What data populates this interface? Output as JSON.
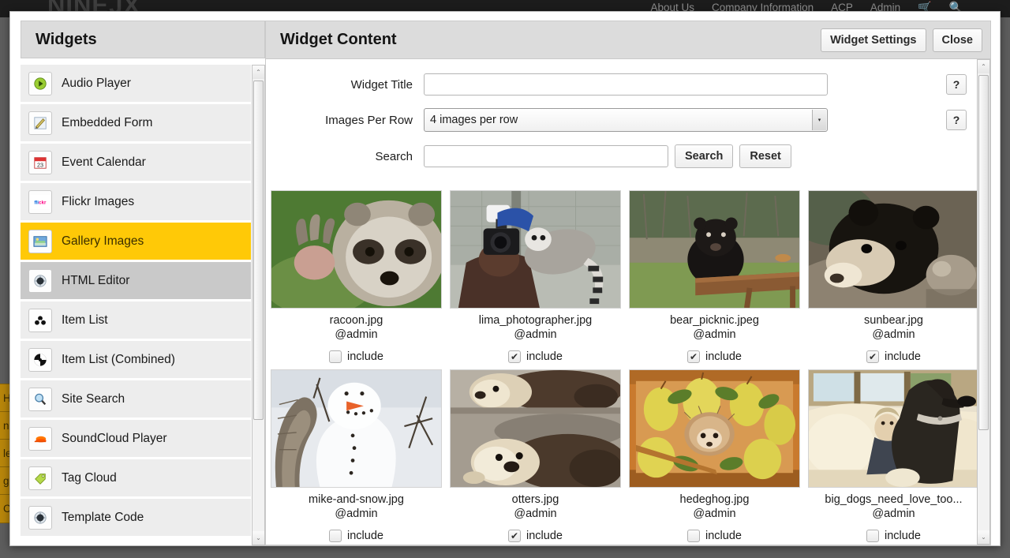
{
  "topnav": {
    "brand": "NINEJX",
    "links": [
      "About Us",
      "Company Information",
      "ACP",
      "Admin"
    ],
    "cart_icon": "cart-icon",
    "search_icon": "search-icon"
  },
  "background_menu": {
    "items": [
      "H",
      "nu",
      "let",
      "ge",
      "Cl"
    ]
  },
  "sidebar": {
    "title": "Widgets",
    "items": [
      {
        "label": "Audio Player",
        "icon": "audio-player-icon",
        "state": "normal"
      },
      {
        "label": "Embedded Form",
        "icon": "embedded-form-icon",
        "state": "normal"
      },
      {
        "label": "Event Calendar",
        "icon": "calendar-icon",
        "state": "normal"
      },
      {
        "label": "Flickr Images",
        "icon": "flickr-icon",
        "state": "normal"
      },
      {
        "label": "Gallery Images",
        "icon": "gallery-icon",
        "state": "selected"
      },
      {
        "label": "HTML Editor",
        "icon": "html-editor-icon",
        "state": "hover"
      },
      {
        "label": "Item List",
        "icon": "item-list-icon",
        "state": "normal"
      },
      {
        "label": "Item List (Combined)",
        "icon": "item-list-combined-icon",
        "state": "normal"
      },
      {
        "label": "Site Search",
        "icon": "site-search-icon",
        "state": "normal"
      },
      {
        "label": "SoundCloud Player",
        "icon": "soundcloud-icon",
        "state": "normal"
      },
      {
        "label": "Tag Cloud",
        "icon": "tag-cloud-icon",
        "state": "normal"
      },
      {
        "label": "Template Code",
        "icon": "template-code-icon",
        "state": "normal"
      }
    ]
  },
  "content": {
    "title": "Widget Content",
    "widget_settings_label": "Widget Settings",
    "close_label": "Close",
    "help_label": "?",
    "form": {
      "widget_title_label": "Widget Title",
      "widget_title_value": "",
      "widget_title_placeholder": "",
      "images_per_row_label": "Images Per Row",
      "images_per_row_value": "4 images per row",
      "search_label": "Search",
      "search_value": "",
      "search_placeholder": "",
      "search_button": "Search",
      "reset_button": "Reset"
    },
    "include_label": "include",
    "gallery_rows": [
      [
        {
          "name": "racoon.jpg",
          "owner": "@admin",
          "included": false,
          "image": "raccoon-photo"
        },
        {
          "name": "lima_photographer.jpg",
          "owner": "@admin",
          "included": true,
          "image": "lemur-photographer-photo"
        },
        {
          "name": "bear_picknic.jpeg",
          "owner": "@admin",
          "included": true,
          "image": "bear-picnic-table-photo"
        },
        {
          "name": "sunbear.jpg",
          "owner": "@admin",
          "included": true,
          "image": "sun-bear-photo"
        }
      ],
      [
        {
          "name": "mike-and-snow.jpg",
          "owner": "@admin",
          "included": false,
          "image": "squirrel-snowman-photo"
        },
        {
          "name": "otters.jpg",
          "owner": "@admin",
          "included": true,
          "image": "otters-water-photo"
        },
        {
          "name": "hedeghog.jpg",
          "owner": "@admin",
          "included": false,
          "image": "hedgehog-pears-photo"
        },
        {
          "name": "big_dogs_need_love_too...",
          "owner": "@admin",
          "included": false,
          "image": "dog-sofa-photo"
        }
      ]
    ]
  },
  "colors": {
    "accent": "#ffc907",
    "header_bg": "#dcdcdc",
    "item_bg": "#ededed",
    "page_bg": "#5d5d5d",
    "topnav_bg": "#1c1c1c",
    "menu_yellow": "#b8860b"
  },
  "scroll": {
    "checkmark": "✔",
    "up_arrow": "⌃",
    "down_arrow": "⌄",
    "select_arrow": "▾"
  }
}
